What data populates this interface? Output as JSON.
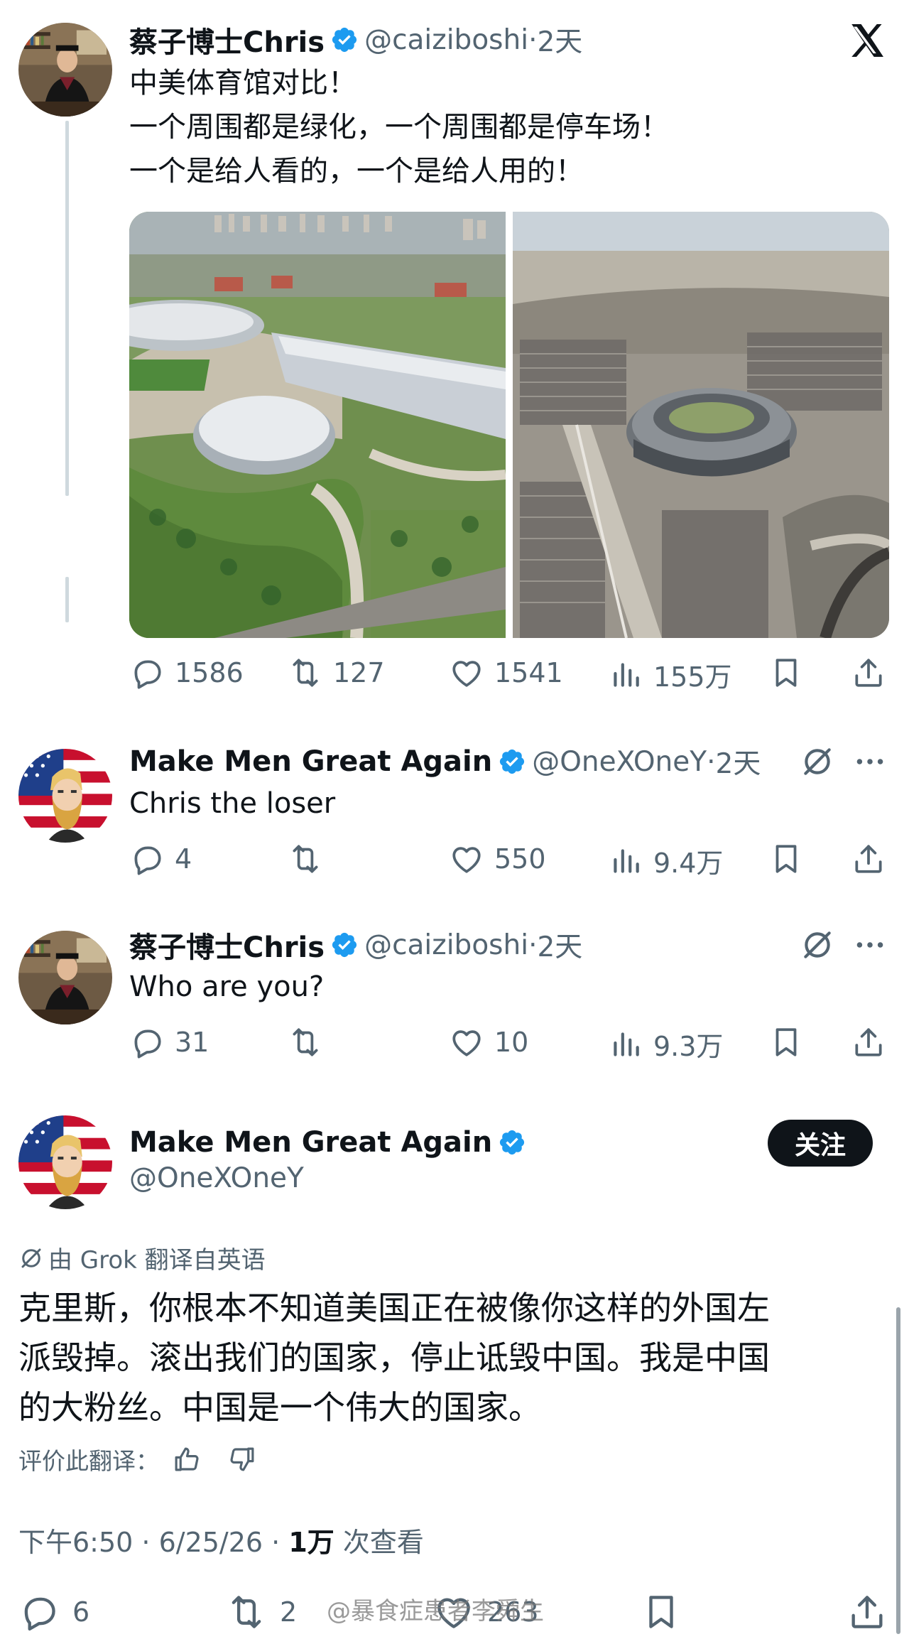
{
  "tweets": [
    {
      "name": "蔡子博士Chris",
      "handle": "@caiziboshi",
      "time": "2天",
      "lines": [
        "中美体育馆对比！",
        "一个周围都是绿化，一个周围都是停车场！",
        "一个是给人看的，一个是给人用的！"
      ],
      "replies": "1586",
      "retweets": "127",
      "likes": "1541",
      "views": "155万"
    },
    {
      "name": "Make Men Great Again",
      "handle": "@OneXOneY",
      "time": "2天",
      "text": "Chris the loser",
      "replies": "4",
      "retweets": "",
      "likes": "550",
      "views": "9.4万"
    },
    {
      "name": "蔡子博士Chris",
      "handle": "@caiziboshi",
      "time": "2天",
      "text": "Who are you?",
      "replies": "31",
      "retweets": "",
      "likes": "10",
      "views": "9.3万"
    }
  ],
  "main_tweet": {
    "name": "Make Men Great Again",
    "handle": "@OneXOneY",
    "follow_label": "关注",
    "grok_label": "由 Grok 翻译自英语",
    "lines": [
      "克里斯，你根本不知道美国正在被像你这样的外国左",
      "派毁掉。滚出我们的国家，停止诋毁中国。我是中国",
      "的大粉丝。中国是一个伟大的国家。"
    ],
    "rate_label": "评价此翻译：",
    "time": "下午6:50",
    "date": "6/25/26",
    "views_count": "1万",
    "views_label": "次查看",
    "replies": "6",
    "retweets": "2",
    "likes": "263"
  },
  "watermark": "@暴食症患者李舜生",
  "colors": {
    "verified": "#1d9bf0",
    "muted": "#536471",
    "text": "#0f1419",
    "thread_line": "#cfd9de"
  },
  "icons": [
    "close-x-icon",
    "verified-badge-icon",
    "reply-icon",
    "retweet-icon",
    "like-icon",
    "views-icon",
    "bookmark-icon",
    "share-icon",
    "grok-icon",
    "thumbs-up-icon",
    "thumbs-down-icon",
    "more-icon"
  ]
}
